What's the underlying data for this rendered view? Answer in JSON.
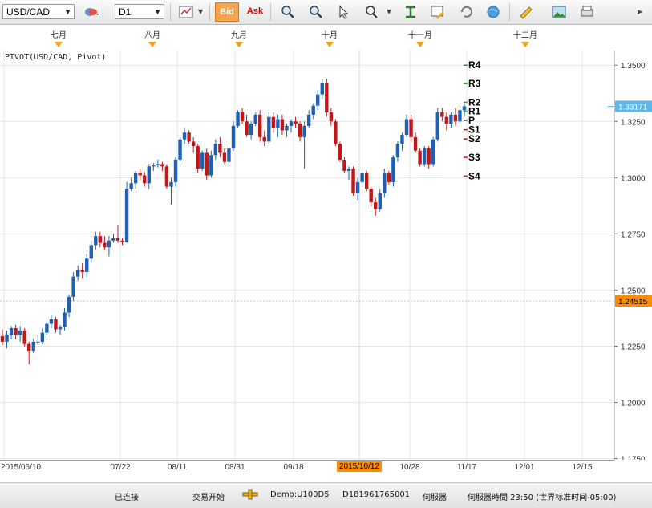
{
  "toolbar": {
    "symbol": "USD/CAD",
    "timeframe": "D1",
    "bid_label": "Bid",
    "ask_label": "Ask"
  },
  "indicator_label": "PIVOT(USD/CAD, Pivot)",
  "months": [
    "七月",
    "八月",
    "九月",
    "十月",
    "十一月",
    "十二月"
  ],
  "chart_data": {
    "type": "candlestick",
    "series_name": "USD/CAD",
    "y_ticks": [
      "1.3500",
      "1.3250",
      "1.3000",
      "1.2750",
      "1.2500",
      "1.2250",
      "1.2000",
      "1.1750"
    ],
    "ylim": [
      1.1745,
      1.3565
    ],
    "x_tick_labels": [
      "2015/06/10",
      "07/22",
      "08/11",
      "08/31",
      "09/18",
      "2015/10/12",
      "10/28",
      "11/17",
      "12/01",
      "12/15"
    ],
    "current_price_label": "1.33171",
    "current_price": 1.33171,
    "crosshair_price_label": "1.24515",
    "crosshair_price": 1.24515,
    "pivot_levels": [
      {
        "label": "R4",
        "value": 1.35
      },
      {
        "label": "R3",
        "value": 1.3418
      },
      {
        "label": "R2",
        "value": 1.3335
      },
      {
        "label": "R1",
        "value": 1.3295
      },
      {
        "label": "P",
        "value": 1.3255
      },
      {
        "label": "S1",
        "value": 1.3213
      },
      {
        "label": "S2",
        "value": 1.3172
      },
      {
        "label": "S3",
        "value": 1.309
      },
      {
        "label": "S4",
        "value": 1.3007
      }
    ],
    "candles": [
      [
        1.2295,
        1.2325,
        1.2255,
        1.227
      ],
      [
        1.227,
        1.232,
        1.224,
        1.23
      ],
      [
        1.23,
        1.234,
        1.228,
        1.233
      ],
      [
        1.233,
        1.2345,
        1.228,
        1.23
      ],
      [
        1.23,
        1.234,
        1.227,
        1.232
      ],
      [
        1.232,
        1.233,
        1.225,
        1.226
      ],
      [
        1.226,
        1.227,
        1.217,
        1.223
      ],
      [
        1.223,
        1.2285,
        1.222,
        1.227
      ],
      [
        1.227,
        1.23,
        1.2255,
        1.227
      ],
      [
        1.227,
        1.233,
        1.226,
        1.231
      ],
      [
        1.231,
        1.236,
        1.23,
        1.235
      ],
      [
        1.235,
        1.239,
        1.233,
        1.237
      ],
      [
        1.237,
        1.238,
        1.231,
        1.2325
      ],
      [
        1.2325,
        1.2345,
        1.23,
        1.2335
      ],
      [
        1.2335,
        1.242,
        1.232,
        1.24
      ],
      [
        1.24,
        1.248,
        1.238,
        1.247
      ],
      [
        1.247,
        1.258,
        1.245,
        1.256
      ],
      [
        1.256,
        1.261,
        1.254,
        1.259
      ],
      [
        1.259,
        1.262,
        1.255,
        1.258
      ],
      [
        1.258,
        1.266,
        1.256,
        1.264
      ],
      [
        1.264,
        1.272,
        1.262,
        1.27
      ],
      [
        1.27,
        1.276,
        1.268,
        1.274
      ],
      [
        1.274,
        1.276,
        1.269,
        1.271
      ],
      [
        1.271,
        1.274,
        1.268,
        1.269
      ],
      [
        1.269,
        1.274,
        1.265,
        1.272
      ],
      [
        1.272,
        1.275,
        1.271,
        1.273
      ],
      [
        1.273,
        1.279,
        1.271,
        1.272
      ],
      [
        1.272,
        1.273,
        1.27,
        1.2715
      ],
      [
        1.2715,
        1.298,
        1.271,
        1.295
      ],
      [
        1.295,
        1.3,
        1.294,
        1.2975
      ],
      [
        1.2975,
        1.303,
        1.295,
        1.302
      ],
      [
        1.302,
        1.304,
        1.299,
        1.301
      ],
      [
        1.301,
        1.3025,
        1.296,
        1.2975
      ],
      [
        1.2975,
        1.306,
        1.295,
        1.305
      ],
      [
        1.305,
        1.3065,
        1.303,
        1.3055
      ],
      [
        1.3055,
        1.308,
        1.3045,
        1.306
      ],
      [
        1.306,
        1.307,
        1.303,
        1.305
      ],
      [
        1.305,
        1.306,
        1.295,
        1.296
      ],
      [
        1.296,
        1.3,
        1.288,
        1.298
      ],
      [
        1.298,
        1.309,
        1.296,
        1.308
      ],
      [
        1.308,
        1.318,
        1.307,
        1.317
      ],
      [
        1.317,
        1.322,
        1.315,
        1.32
      ],
      [
        1.32,
        1.321,
        1.315,
        1.316
      ],
      [
        1.316,
        1.318,
        1.311,
        1.314
      ],
      [
        1.314,
        1.315,
        1.302,
        1.304
      ],
      [
        1.304,
        1.312,
        1.303,
        1.311
      ],
      [
        1.311,
        1.313,
        1.299,
        1.301
      ],
      [
        1.301,
        1.312,
        1.3,
        1.31
      ],
      [
        1.31,
        1.317,
        1.308,
        1.315
      ],
      [
        1.315,
        1.318,
        1.309,
        1.311
      ],
      [
        1.311,
        1.313,
        1.306,
        1.307
      ],
      [
        1.307,
        1.314,
        1.305,
        1.313
      ],
      [
        1.313,
        1.325,
        1.312,
        1.323
      ],
      [
        1.323,
        1.33,
        1.322,
        1.329
      ],
      [
        1.329,
        1.331,
        1.324,
        1.325
      ],
      [
        1.325,
        1.328,
        1.318,
        1.319
      ],
      [
        1.319,
        1.325,
        1.317,
        1.324
      ],
      [
        1.324,
        1.329,
        1.323,
        1.328
      ],
      [
        1.328,
        1.33,
        1.316,
        1.318
      ],
      [
        1.318,
        1.321,
        1.314,
        1.316
      ],
      [
        1.316,
        1.329,
        1.315,
        1.327
      ],
      [
        1.327,
        1.329,
        1.32,
        1.322
      ],
      [
        1.322,
        1.328,
        1.318,
        1.326
      ],
      [
        1.326,
        1.328,
        1.319,
        1.321
      ],
      [
        1.321,
        1.324,
        1.318,
        1.323
      ],
      [
        1.323,
        1.326,
        1.32,
        1.325
      ],
      [
        1.325,
        1.327,
        1.322,
        1.324
      ],
      [
        1.324,
        1.325,
        1.316,
        1.318
      ],
      [
        1.318,
        1.325,
        1.304,
        1.323
      ],
      [
        1.323,
        1.33,
        1.322,
        1.328
      ],
      [
        1.328,
        1.333,
        1.326,
        1.332
      ],
      [
        1.332,
        1.339,
        1.33,
        1.337
      ],
      [
        1.337,
        1.344,
        1.335,
        1.342
      ],
      [
        1.342,
        1.344,
        1.327,
        1.329
      ],
      [
        1.329,
        1.331,
        1.323,
        1.325
      ],
      [
        1.325,
        1.326,
        1.314,
        1.315
      ],
      [
        1.315,
        1.316,
        1.307,
        1.308
      ],
      [
        1.308,
        1.309,
        1.302,
        1.303
      ],
      [
        1.303,
        1.305,
        1.299,
        1.304
      ],
      [
        1.304,
        1.305,
        1.292,
        1.293
      ],
      [
        1.293,
        1.3,
        1.29,
        1.298
      ],
      [
        1.298,
        1.304,
        1.296,
        1.302
      ],
      [
        1.302,
        1.303,
        1.294,
        1.295
      ],
      [
        1.295,
        1.296,
        1.287,
        1.289
      ],
      [
        1.289,
        1.291,
        1.283,
        1.286
      ],
      [
        1.286,
        1.295,
        1.285,
        1.293
      ],
      [
        1.293,
        1.304,
        1.291,
        1.302
      ],
      [
        1.302,
        1.303,
        1.297,
        1.298
      ],
      [
        1.298,
        1.31,
        1.296,
        1.309
      ],
      [
        1.309,
        1.316,
        1.307,
        1.315
      ],
      [
        1.315,
        1.32,
        1.312,
        1.319
      ],
      [
        1.319,
        1.328,
        1.318,
        1.326
      ],
      [
        1.326,
        1.328,
        1.316,
        1.318
      ],
      [
        1.318,
        1.32,
        1.311,
        1.312
      ],
      [
        1.312,
        1.313,
        1.305,
        1.306
      ],
      [
        1.306,
        1.314,
        1.305,
        1.313
      ],
      [
        1.313,
        1.314,
        1.304,
        1.306
      ],
      [
        1.306,
        1.318,
        1.305,
        1.317
      ],
      [
        1.317,
        1.331,
        1.316,
        1.329
      ],
      [
        1.329,
        1.331,
        1.325,
        1.327
      ],
      [
        1.327,
        1.329,
        1.321,
        1.324
      ],
      [
        1.324,
        1.329,
        1.322,
        1.328
      ],
      [
        1.328,
        1.331,
        1.323,
        1.325
      ],
      [
        1.325,
        1.332,
        1.324,
        1.33
      ],
      [
        1.33,
        1.333,
        1.327,
        1.3317
      ]
    ]
  },
  "status": {
    "connection": "已连接",
    "session": "交易开始",
    "account": "Demo:U100D5",
    "account_id": "D181961765001",
    "server": "伺服器",
    "server_time": "伺服器時間 23:50 (世界标准时间-05:00)"
  }
}
